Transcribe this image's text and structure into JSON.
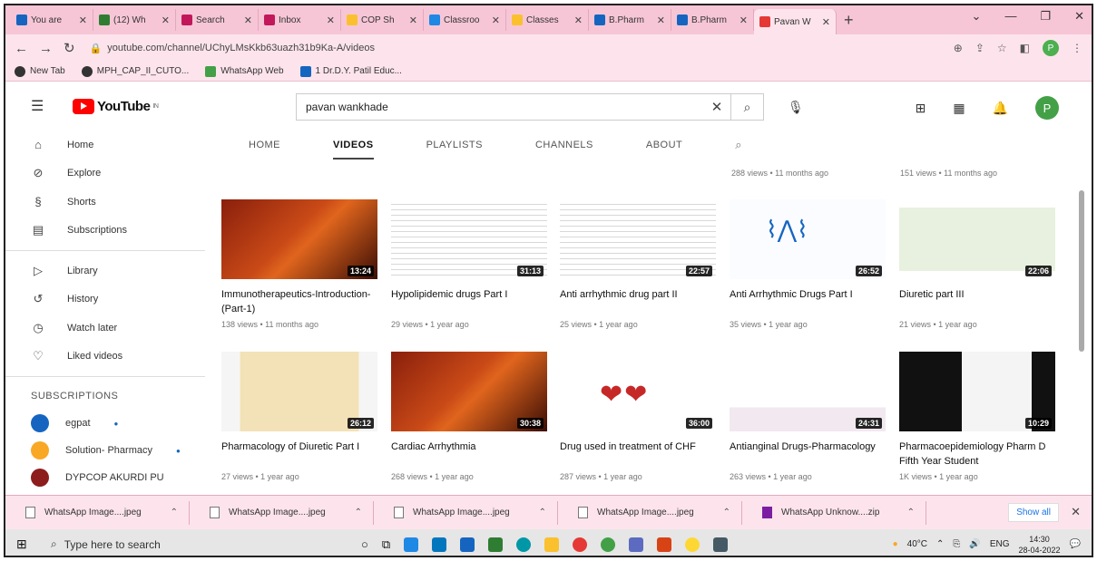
{
  "browser": {
    "tabs": [
      {
        "label": "You are",
        "color": "#1565c0"
      },
      {
        "label": "(12) Wh",
        "color": "#2e7d32"
      },
      {
        "label": "Search",
        "color": "#c2185b"
      },
      {
        "label": "Inbox",
        "color": "#c2185b"
      },
      {
        "label": "COP Sh",
        "color": "#fbc02d"
      },
      {
        "label": "Classroo",
        "color": "#1e88e5"
      },
      {
        "label": "Classes",
        "color": "#fbc02d"
      },
      {
        "label": "B.Pharm",
        "color": "#1565c0"
      },
      {
        "label": "B.Pharm",
        "color": "#1565c0"
      },
      {
        "label": "Pavan W",
        "color": "#e53935",
        "active": true
      }
    ],
    "url": "youtube.com/channel/UChyLMsKkb63uazh31b9Ka-A/videos",
    "profile_initial": "P",
    "bookmarks": [
      {
        "label": "New Tab"
      },
      {
        "label": "MPH_CAP_II_CUTO..."
      },
      {
        "label": "WhatsApp Web"
      },
      {
        "label": "1 Dr.D.Y. Patil Educ..."
      }
    ]
  },
  "youtube": {
    "logo_text": "YouTube",
    "logo_sup": "IN",
    "search_value": "pavan wankhade",
    "avatar_initial": "P"
  },
  "sidebar": {
    "items": [
      {
        "label": "Home",
        "icon": "home-icon",
        "glyph": "⌂"
      },
      {
        "label": "Explore",
        "icon": "explore-icon",
        "glyph": "⊘"
      },
      {
        "label": "Shorts",
        "icon": "shorts-icon",
        "glyph": "§"
      },
      {
        "label": "Subscriptions",
        "icon": "subscriptions-icon",
        "glyph": "▤"
      }
    ],
    "items2": [
      {
        "label": "Library",
        "icon": "library-icon",
        "glyph": "▷"
      },
      {
        "label": "History",
        "icon": "history-icon",
        "glyph": "↺"
      },
      {
        "label": "Watch later",
        "icon": "watch-later-icon",
        "glyph": "◷"
      },
      {
        "label": "Liked videos",
        "icon": "liked-videos-icon",
        "glyph": "♡"
      }
    ],
    "subscriptions_heading": "SUBSCRIPTIONS",
    "channels": [
      {
        "name": "egpat",
        "color": "#1565c0",
        "dot": true
      },
      {
        "name": "Solution- Pharmacy",
        "color": "#f9a825",
        "dot": true
      },
      {
        "name": "DYPCOP AKURDI PU",
        "color": "#8d1c1c",
        "dot": false
      }
    ]
  },
  "channel_tabs": [
    "HOME",
    "VIDEOS",
    "PLAYLISTS",
    "CHANNELS",
    "ABOUT"
  ],
  "top_row_meta": [
    "288 views • 11 months ago",
    "151 views • 11 months ago"
  ],
  "videos": [
    {
      "title": "Immunotherapeutics-Introduction-(Part-1)",
      "meta": "138 views • 11 months ago",
      "duration": "13:24",
      "style": "orange"
    },
    {
      "title": "Hypolipidemic drugs Part I",
      "meta": "29 views • 1 year ago",
      "duration": "31:13",
      "style": "doc"
    },
    {
      "title": "Anti arrhythmic drug part II",
      "meta": "25 views • 1 year ago",
      "duration": "22:57",
      "style": "doc"
    },
    {
      "title": "Anti Arrhythmic Drugs Part I",
      "meta": "35 views • 1 year ago",
      "duration": "26:52",
      "style": "ecg"
    },
    {
      "title": "Diuretic part III",
      "meta": "21 views • 1 year ago",
      "duration": "22:06",
      "style": "diagram"
    },
    {
      "title": "Pharmacology of Diuretic Part I",
      "meta": "27 views • 1 year ago",
      "duration": "26:12",
      "style": "kidney"
    },
    {
      "title": "Cardiac Arrhythmia",
      "meta": "268 views • 1 year ago",
      "duration": "30:38",
      "style": "orange"
    },
    {
      "title": "Drug used in treatment of CHF",
      "meta": "287 views • 1 year ago",
      "duration": "36:00",
      "style": "heart"
    },
    {
      "title": "Antianginal Drugs-Pharmacology",
      "meta": "263 views • 1 year ago",
      "duration": "24:31",
      "style": "slide"
    },
    {
      "title": "Pharmacoepidemiology Pharm D Fifth Year Student",
      "meta": "1K views • 1 year ago",
      "duration": "10:29",
      "style": "dark"
    }
  ],
  "downloads": {
    "items": [
      "WhatsApp Image....jpeg",
      "WhatsApp Image....jpeg",
      "WhatsApp Image....jpeg",
      "WhatsApp Image....jpeg",
      "WhatsApp Unknow....zip"
    ],
    "show_all": "Show all"
  },
  "taskbar": {
    "search_placeholder": "Type here to search",
    "temperature": "40°C",
    "language": "ENG",
    "time": "14:30",
    "date": "28-04-2022"
  }
}
